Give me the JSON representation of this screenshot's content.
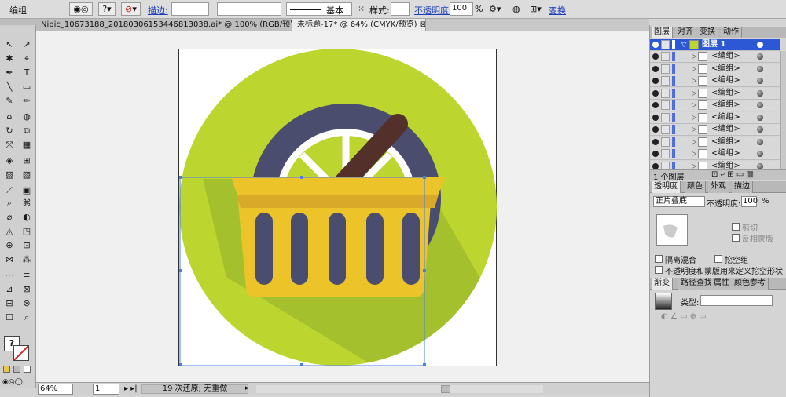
{
  "control_bar": {
    "object_type": "编组",
    "stroke_label": "描边:",
    "profile_value": "基本",
    "style_label": "样式:",
    "opacity_label": "不透明度:",
    "opacity_value": "100",
    "opacity_unit": "%",
    "transform_label": "变换"
  },
  "doc_tabs": [
    {
      "label": "Nipic_10673188_20180306153446813038.ai* @ 100% (RGB/预览)",
      "close": "⊠"
    },
    {
      "label": "未标题-17* @ 64% (CMYK/预览)",
      "close": "⊠"
    }
  ],
  "tools": [
    "↖",
    "↗",
    "✱",
    "⌖",
    "✒",
    "T",
    "╲",
    "▭",
    "✎",
    "✏",
    "⌂",
    "◍",
    "↻",
    "⧉",
    "⤧",
    "▦",
    "◈",
    "⊞",
    "▧",
    "▨",
    "⟋",
    "▣",
    "⌕",
    "⌘",
    "⌀",
    "◐",
    "◬",
    "◳",
    "⊕",
    "⊡",
    "⋈",
    "⁂",
    "⋯",
    "≡",
    "⊿",
    "⊠",
    "⊟",
    "⊗",
    "☐",
    "⌕"
  ],
  "status_bar": {
    "zoom": "64%",
    "artboard": "1",
    "history": "19 次还原; 无重做"
  },
  "layers_panel": {
    "tabs": [
      "图层",
      "对齐",
      "变换",
      "动作"
    ],
    "layer_name": "图层 1",
    "rows": [
      "<编组>",
      "<编组>",
      "<编组>",
      "<编组>",
      "<编组>",
      "<编组>",
      "<编组>",
      "<编组>",
      "<编组>",
      "<编组>"
    ],
    "count": "1 个图层"
  },
  "transparency_panel": {
    "tabs": [
      "透明度",
      "颜色",
      "外观",
      "描边"
    ],
    "blend_mode": "正片叠底",
    "opacity_label": "不透明度:",
    "opacity_value": "100",
    "opacity_unit": "%",
    "clip_label": "剪切",
    "invert_label": "反相蒙版",
    "isolate_label": "隔离混合",
    "knockout_label": "挖空组",
    "opacity_mask_label": "不透明度和蒙版用来定义挖空形状"
  },
  "gradient_panel": {
    "tabs": [
      "渐变",
      "路径查找",
      "属性",
      "颜色参考"
    ],
    "type_label": "类型:"
  },
  "colors": {
    "circle": "#bcd62f",
    "shadow": "#a4c02c",
    "tire": "#4a4d6e",
    "rim": "#ffffff",
    "basket": "#ecc429",
    "basket_dark": "#d9a92a",
    "handle": "#54302a",
    "selection": "#4a7cf0"
  }
}
